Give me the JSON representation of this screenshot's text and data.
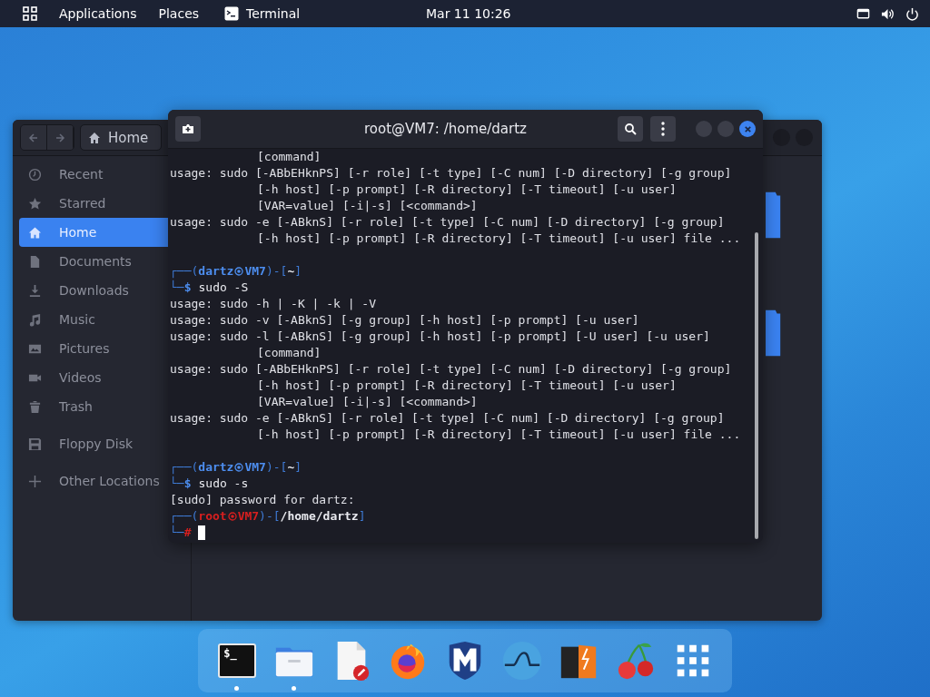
{
  "top_bar": {
    "menus": [
      {
        "label": "Applications"
      },
      {
        "label": "Places"
      }
    ],
    "app": {
      "label": "Terminal"
    },
    "clock": "Mar 11  10:26"
  },
  "file_manager": {
    "path": {
      "label": "Home"
    },
    "sidebar": {
      "sections": [
        [
          {
            "label": "Recent",
            "selected": false
          },
          {
            "label": "Starred",
            "selected": false
          },
          {
            "label": "Home",
            "selected": true
          },
          {
            "label": "Documents",
            "selected": false
          },
          {
            "label": "Downloads",
            "selected": false
          },
          {
            "label": "Music",
            "selected": false
          },
          {
            "label": "Pictures",
            "selected": false
          },
          {
            "label": "Videos",
            "selected": false
          },
          {
            "label": "Trash",
            "selected": false
          }
        ],
        [
          {
            "label": "Floppy Disk",
            "selected": false
          }
        ],
        [
          {
            "label": "Other Locations",
            "selected": false
          }
        ]
      ]
    }
  },
  "terminal": {
    "title": "root@VM7: /home/dartz",
    "lines": [
      {
        "kind": "output",
        "indent": true,
        "text": "[command]"
      },
      {
        "kind": "output",
        "indent": false,
        "text": "usage: sudo [-ABbEHknPS] [-r role] [-t type] [-C num] [-D directory] [-g group]"
      },
      {
        "kind": "output",
        "indent": true,
        "text": "[-h host] [-p prompt] [-R directory] [-T timeout] [-u user]"
      },
      {
        "kind": "output",
        "indent": true,
        "text": "[VAR=value] [-i|-s] [<command>]"
      },
      {
        "kind": "output",
        "indent": false,
        "text": "usage: sudo -e [-ABknS] [-r role] [-t type] [-C num] [-D directory] [-g group]"
      },
      {
        "kind": "output",
        "indent": true,
        "text": "[-h host] [-p prompt] [-R directory] [-T timeout] [-u user] file ..."
      },
      {
        "kind": "blank"
      },
      {
        "kind": "prompt",
        "root": false,
        "lead": "┌──(",
        "user": "dartz",
        "host": "VM7",
        "mid": ")-[",
        "dir": "~",
        "tail": "]"
      },
      {
        "kind": "input",
        "root": false,
        "lead": "└─",
        "symbol": "$",
        "command": "sudo -S"
      },
      {
        "kind": "output",
        "indent": false,
        "text": "usage: sudo -h | -K | -k | -V"
      },
      {
        "kind": "output",
        "indent": false,
        "text": "usage: sudo -v [-ABknS] [-g group] [-h host] [-p prompt] [-u user]"
      },
      {
        "kind": "output",
        "indent": false,
        "text": "usage: sudo -l [-ABknS] [-g group] [-h host] [-p prompt] [-U user] [-u user]"
      },
      {
        "kind": "output",
        "indent": true,
        "text": "[command]"
      },
      {
        "kind": "output",
        "indent": false,
        "text": "usage: sudo [-ABbEHknPS] [-r role] [-t type] [-C num] [-D directory] [-g group]"
      },
      {
        "kind": "output",
        "indent": true,
        "text": "[-h host] [-p prompt] [-R directory] [-T timeout] [-u user]"
      },
      {
        "kind": "output",
        "indent": true,
        "text": "[VAR=value] [-i|-s] [<command>]"
      },
      {
        "kind": "output",
        "indent": false,
        "text": "usage: sudo -e [-ABknS] [-r role] [-t type] [-C num] [-D directory] [-g group]"
      },
      {
        "kind": "output",
        "indent": true,
        "text": "[-h host] [-p prompt] [-R directory] [-T timeout] [-u user] file ..."
      },
      {
        "kind": "blank"
      },
      {
        "kind": "prompt",
        "root": false,
        "lead": "┌──(",
        "user": "dartz",
        "host": "VM7",
        "mid": ")-[",
        "dir": "~",
        "tail": "]"
      },
      {
        "kind": "input",
        "root": false,
        "lead": "└─",
        "symbol": "$",
        "command": "sudo -s"
      },
      {
        "kind": "output",
        "indent": false,
        "text": "[sudo] password for dartz:"
      },
      {
        "kind": "prompt",
        "root": true,
        "lead": "┌──(",
        "user": "root",
        "host": "VM7",
        "mid": ")-[",
        "dir": "/home/dartz",
        "tail": "]"
      },
      {
        "kind": "input",
        "root": true,
        "lead": "└─",
        "symbol": "#",
        "cursor": true
      }
    ]
  },
  "dock": [
    {
      "kind": "terminal",
      "glyph": "$_",
      "running": true
    },
    {
      "kind": "files",
      "running": true
    },
    {
      "kind": "editor",
      "running": false
    },
    {
      "kind": "browser",
      "running": false
    },
    {
      "kind": "shield",
      "running": false
    },
    {
      "kind": "fin",
      "running": false
    },
    {
      "kind": "bolt-box",
      "running": false
    },
    {
      "kind": "cherries",
      "running": false
    },
    {
      "kind": "app-grid",
      "running": false
    }
  ]
}
